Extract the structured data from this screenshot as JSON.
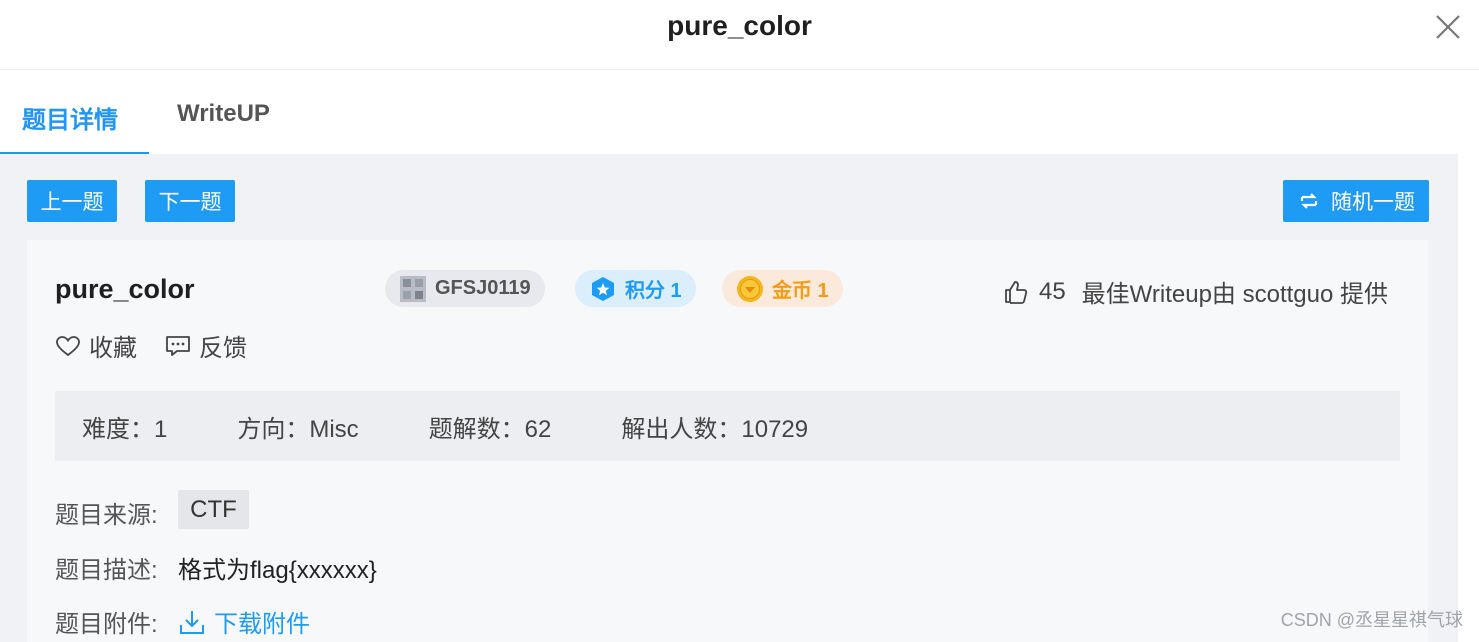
{
  "header": {
    "title": "pure_color",
    "close_icon": "close-icon"
  },
  "tabs": [
    {
      "label": "题目详情",
      "active": true
    },
    {
      "label": "WriteUP",
      "active": false
    }
  ],
  "toolbar": {
    "prev_label": "上一题",
    "next_label": "下一题",
    "random_label": "随机一题",
    "random_icon": "shuffle-icon"
  },
  "problem": {
    "title": "pure_color",
    "id_badge": "GFSJ0119",
    "score_badge": "积分 1",
    "coin_badge": "金币 1",
    "likes": "45",
    "writeup_credit": "最佳Writeup由 scottguo 提供",
    "favorite_label": "收藏",
    "feedback_label": "反馈"
  },
  "stats": {
    "difficulty": "难度：1",
    "direction": "方向：Misc",
    "solutions": "题解数：62",
    "solvers": "解出人数：10729"
  },
  "fields": {
    "source_label": "题目来源:",
    "source_value": "CTF",
    "description_label": "题目描述:",
    "description_value": "格式为flag{xxxxxx}",
    "attachment_label": "题目附件:",
    "attachment_link": "下载附件"
  },
  "watermark": "CSDN @丞星星祺气球",
  "colors": {
    "accent": "#1e9bf5",
    "coin": "#f39c12",
    "background": "#f0f2f5"
  }
}
